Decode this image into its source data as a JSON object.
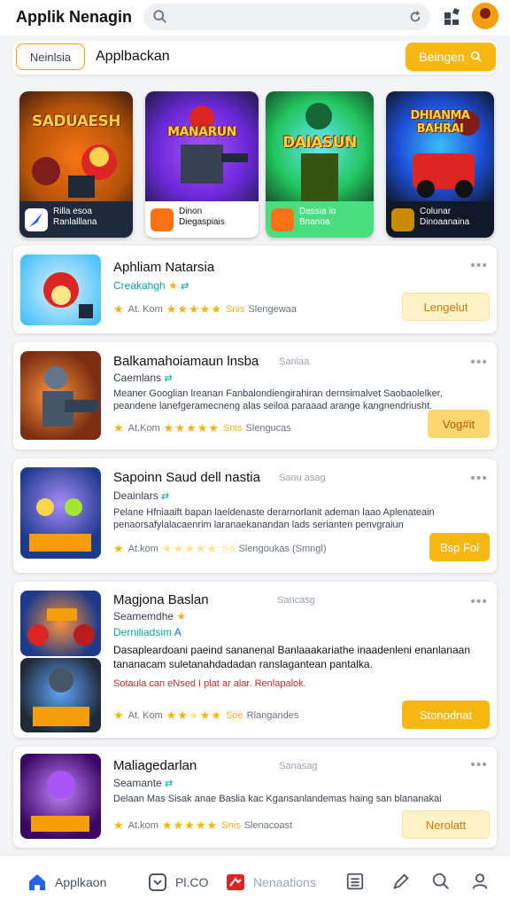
{
  "header": {
    "title": "Applik Nenagin",
    "search_placeholder": ""
  },
  "filter": {
    "chip": "Neinlsia",
    "label": "Applbackan",
    "search_button": "Beingen"
  },
  "featured": [
    {
      "art_title": "SADUAESH",
      "line1": "Rilla esoa",
      "line2": "Ranlalllana",
      "colors": [
        "#f59e0b",
        "#b45309",
        "#1f2937"
      ]
    },
    {
      "art_title": "MANARUN",
      "line1": "Dinon",
      "line2": "Diegaspiais",
      "colors": [
        "#6d28d9",
        "#a855f7",
        "#1e1b4b"
      ]
    },
    {
      "art_title": "DAIASUN",
      "line1": "Dassia io",
      "line2": "Bnanoa",
      "colors": [
        "#22c55e",
        "#0ea5e9",
        "#14532d"
      ]
    },
    {
      "art_title": "DHIANMA BAHRAI",
      "line1": "Colunar",
      "line2": "Dinoaanaina",
      "colors": [
        "#ef4444",
        "#0ea5e9",
        "#1f2937"
      ]
    }
  ],
  "items": [
    {
      "title": "Aphliam Natarsia",
      "subtitle": "Creakahgh",
      "meta_left": "At. Kom",
      "meta_right": "Slengewaa",
      "rating_label": "Snis",
      "action": "Lengelut",
      "action_style": "light"
    },
    {
      "title": "Balkamahoiamaun lnsba",
      "date": "Sanlaa",
      "subtitle": "Caemlans",
      "desc": "Meaner Googlian lreanan Fanbalondiengirahiran dernsimalvet Saobaolelker, peandene lanefgeramecneng alas seiloa paraaad arange kangnendriusht.",
      "meta_left": "At.Kom",
      "meta_right": "Slengucas",
      "rating_label": "Snis",
      "action": "Vog#it",
      "action_style": "mid"
    },
    {
      "title": "Sapoinn Saud dell nastia",
      "date": "Sanu asag",
      "subtitle": "Deainlars",
      "desc": "Pelane Hfniaaift bapan laeldenaste derarnorlanit ademan laao Aplenateain penaorsafylalacaenrim laranaekanandan lads serianten penvgraiun",
      "meta_left": "At.kom",
      "meta_right": "Slengoukas (Smngl)",
      "rating_label": "Sis",
      "action": "Bsp Fol",
      "action_style": "solid"
    },
    {
      "title": "Magjona Baslan",
      "date": "Sancasg",
      "subtitle": "Seamemdhe",
      "subtitle2": "Derniliadsim",
      "desc": "Dasapleardoani paeind sananenal Banlaaakariathe inaadenleni enanlanaan tananacam suletanahdadadan ranslagantean pantalka.",
      "note": "Sotaula can eNsed I plat ar alar. Renlapalok.",
      "meta_left": "At. Kom",
      "meta_right": "Rlangandes",
      "rating_label": "Soe",
      "action": "Stonodnat",
      "action_style": "solid"
    },
    {
      "title": "Maliagedarlan",
      "date": "Sanasag",
      "subtitle": "Seamante",
      "desc": "Delaan Mas Sisak anae Baslia kac Kgansanlandemas haing san blananakai",
      "meta_left": "At.kom",
      "meta_right": "Slenacoast",
      "rating_label": "Snis",
      "action": "Nerolatt",
      "action_style": "light"
    }
  ],
  "nav": {
    "home": "Applkaon",
    "pco": "Pl.CO",
    "notifications": "Nenaations"
  },
  "colors": {
    "accent": "#f8b814",
    "teal": "#0ea5a5",
    "home_blue": "#2563eb",
    "red": "#dc2626"
  }
}
